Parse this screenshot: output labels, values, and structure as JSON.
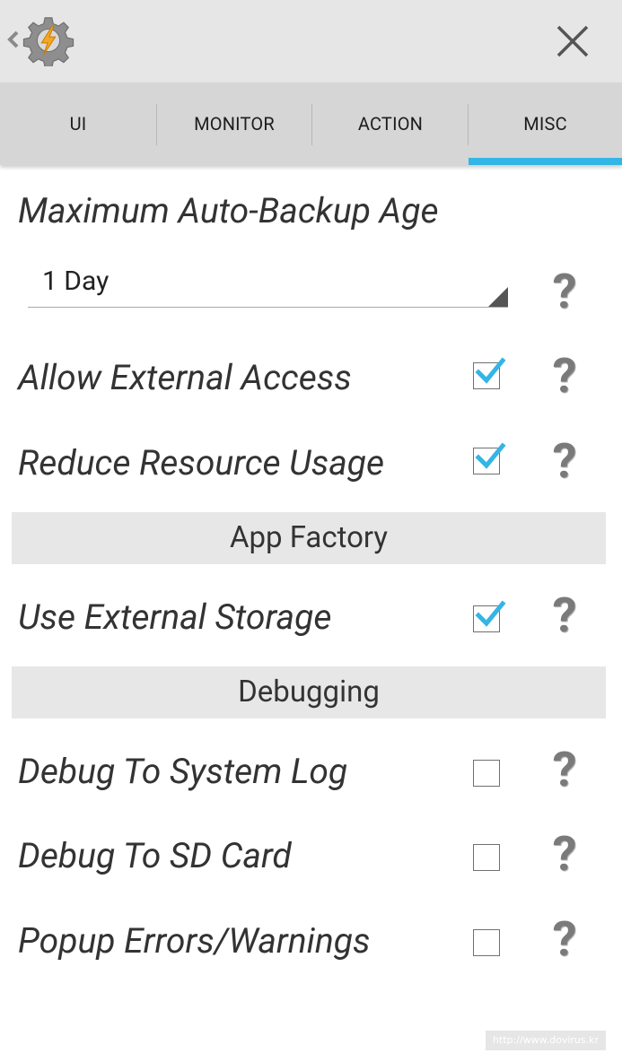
{
  "app": {
    "back_icon": "chevron-left-icon",
    "app_icon": "tasker-gear-bolt-icon",
    "close_icon": "close-icon"
  },
  "tabs": [
    {
      "label": "UI",
      "selected": false
    },
    {
      "label": "MONITOR",
      "selected": false
    },
    {
      "label": "ACTION",
      "selected": false
    },
    {
      "label": "MISC",
      "selected": true
    }
  ],
  "accent_color": "#33b5e5",
  "prefs": {
    "backup_age": {
      "label": "Maximum Auto-Backup Age",
      "value": "1 Day"
    },
    "external_access": {
      "label": "Allow External Access",
      "checked": true
    },
    "reduce_resource": {
      "label": "Reduce Resource Usage",
      "checked": true
    },
    "use_external_storage": {
      "label": "Use External Storage",
      "checked": true
    },
    "debug_system_log": {
      "label": "Debug To System Log",
      "checked": false
    },
    "debug_sd_card": {
      "label": "Debug To SD Card",
      "checked": false
    },
    "popup_errors": {
      "label": "Popup Errors/Warnings",
      "checked": false
    }
  },
  "sections": {
    "app_factory": "App Factory",
    "debugging": "Debugging"
  },
  "help_symbol": "?",
  "watermark": "http://www.dovirus.kr"
}
